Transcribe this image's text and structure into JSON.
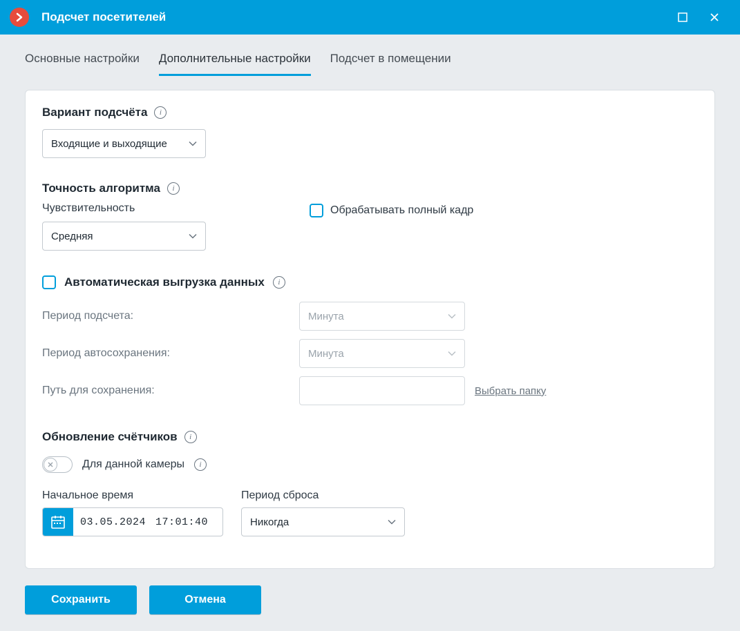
{
  "window": {
    "title": "Подсчет посетителей"
  },
  "tabs": {
    "basic": "Основные настройки",
    "advanced": "Дополнительные настройки",
    "room": "Подсчет в помещении"
  },
  "count_variant": {
    "heading": "Вариант подсчёта",
    "value": "Входящие и выходящие"
  },
  "accuracy": {
    "heading": "Точность алгоритма",
    "sensitivity_label": "Чувствительность",
    "sensitivity_value": "Средняя",
    "full_frame_label": "Обрабатывать полный кадр"
  },
  "auto_export": {
    "label": "Автоматическая выгрузка данных",
    "count_period_label": "Период подсчета:",
    "count_period_value": "Минута",
    "autosave_period_label": "Период автосохранения:",
    "autosave_period_value": "Минута",
    "save_path_label": "Путь для сохранения:",
    "save_path_value": "",
    "choose_folder": "Выбрать папку"
  },
  "counters": {
    "heading": "Обновление счётчиков",
    "per_camera_label": "Для данной камеры",
    "start_time_label": "Начальное время",
    "start_date": "03.05.2024",
    "start_time": "17:01:40",
    "reset_period_label": "Период сброса",
    "reset_period_value": "Никогда"
  },
  "buttons": {
    "save": "Сохранить",
    "cancel": "Отмена"
  }
}
